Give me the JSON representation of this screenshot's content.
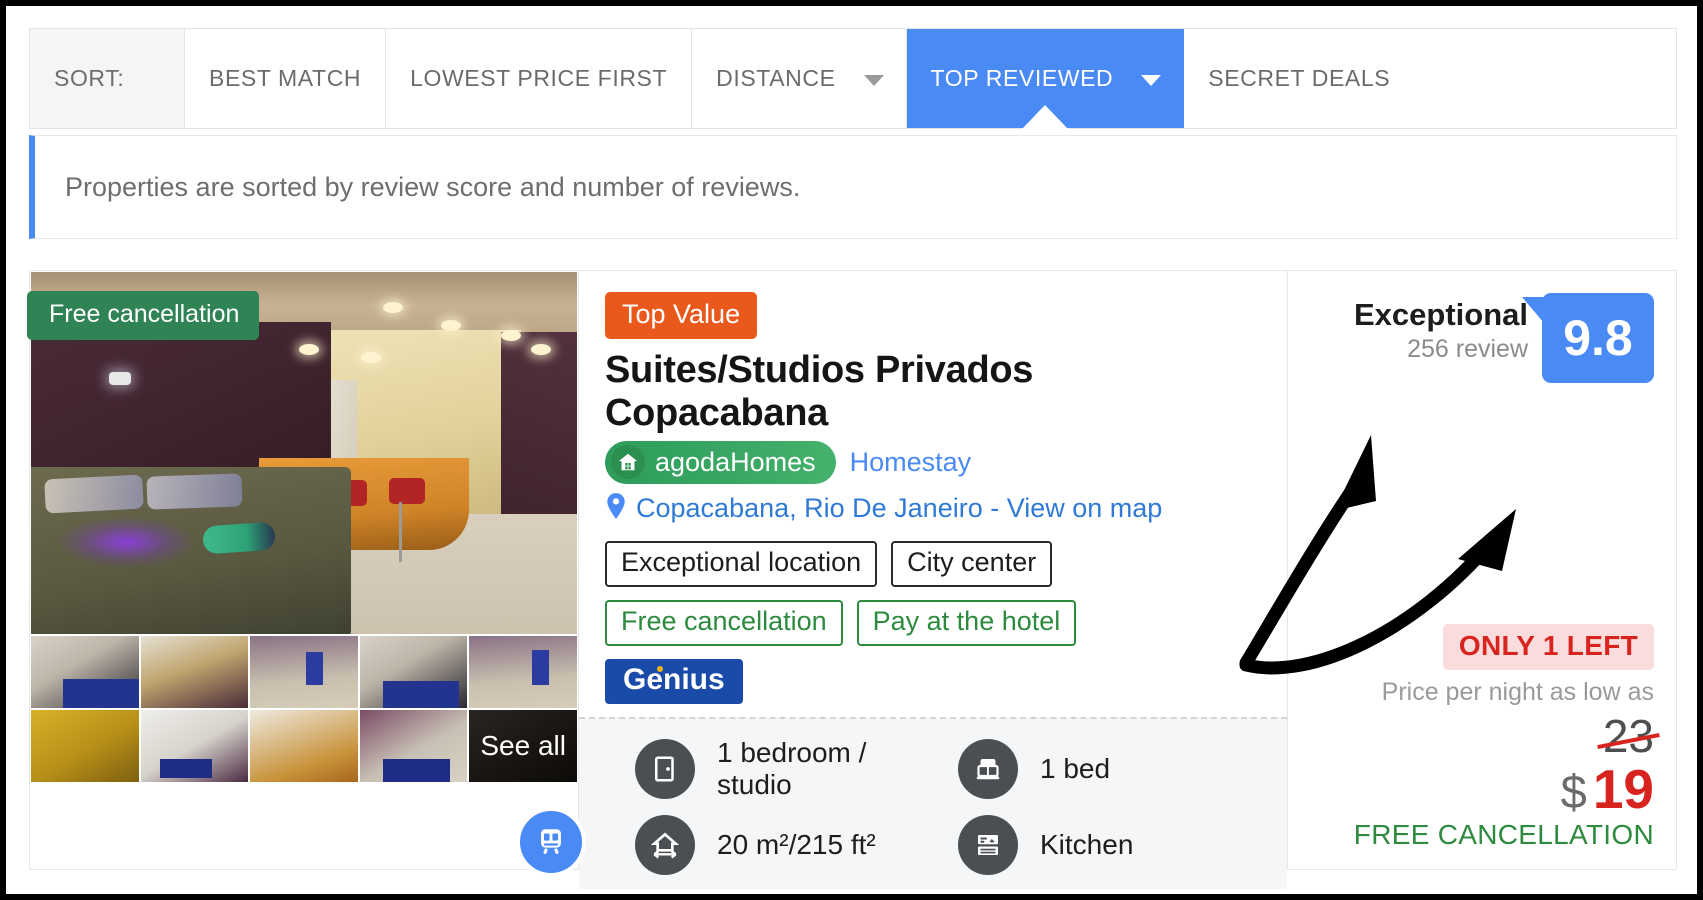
{
  "sort_bar": {
    "items": [
      {
        "label": "SORT:",
        "type": "label",
        "active": false,
        "caret": false
      },
      {
        "label": "BEST MATCH",
        "type": "tab",
        "active": false,
        "caret": false
      },
      {
        "label": "LOWEST PRICE FIRST",
        "type": "tab",
        "active": false,
        "caret": false
      },
      {
        "label": "DISTANCE",
        "type": "tab",
        "active": false,
        "caret": true
      },
      {
        "label": "TOP REVIEWED",
        "type": "tab",
        "active": true,
        "caret": true
      },
      {
        "label": "SECRET DEALS",
        "type": "tab",
        "active": false,
        "caret": false
      }
    ]
  },
  "info_banner": {
    "text": "Properties are sorted by review score and number of reviews."
  },
  "card": {
    "photo": {
      "free_cancellation_overlay": "Free cancellation",
      "metro_icon": "metro-train-icon",
      "see_all_label": "See all",
      "thumbnail_count": 10
    },
    "top_value_badge": "Top Value",
    "hotel_name": "Suites/Studios Privados Copacabana",
    "brand_pill": "agodaHomes",
    "brand_icon": "home-icon",
    "property_type": "Homestay",
    "location_icon": "map-pin-icon",
    "location": "Copacabana, Rio De Janeiro - View on map",
    "tags_dark": [
      "Exceptional location",
      "City center"
    ],
    "tags_green": [
      "Free cancellation",
      "Pay at the hotel"
    ],
    "genius_badge": "Genius",
    "facts": [
      {
        "icon": "door-icon",
        "text": "1 bedroom / studio"
      },
      {
        "icon": "bed-icon",
        "text": "1 bed"
      },
      {
        "icon": "area-size-icon",
        "text": "20 m²/215 ft²"
      },
      {
        "icon": "kitchen-icon",
        "text": "Kitchen"
      }
    ],
    "review": {
      "label": "Exceptional",
      "count": "256 review",
      "score": "9.8"
    },
    "price": {
      "only_left_badge": "ONLY 1 LEFT",
      "note": "Price per night as low as",
      "old_price": "23",
      "currency": "$",
      "new_price": "19",
      "free_cancellation": "FREE CANCELLATION"
    }
  },
  "colors": {
    "accent_blue": "#4a8af4",
    "badge_orange": "#e9591b",
    "green": "#2d8a3e",
    "pill_green": "#2f8354",
    "red": "#d8241f",
    "genius_blue": "#1a4ba8",
    "facts_bg": "#f4f6f7"
  }
}
